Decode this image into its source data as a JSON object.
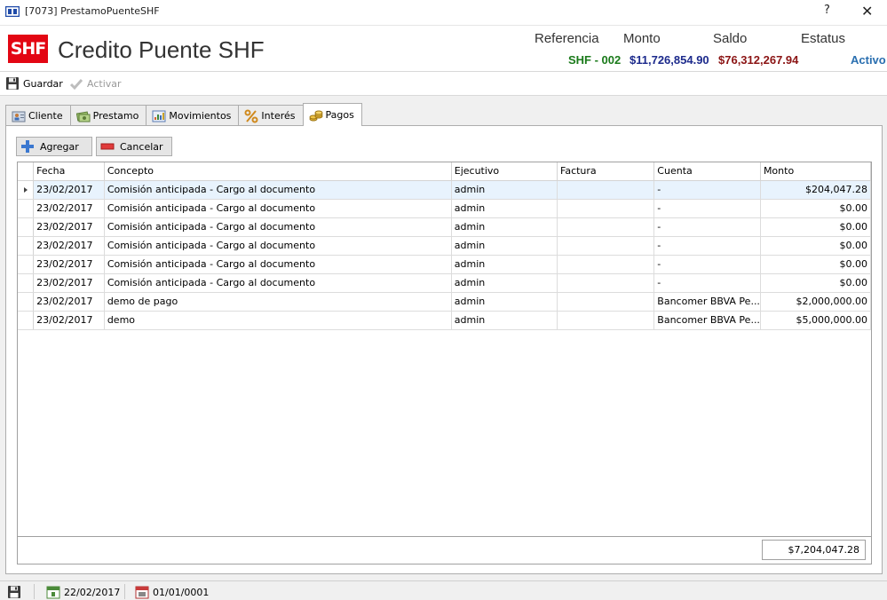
{
  "window": {
    "title": "[7073] PrestamoPuenteSHF",
    "help": "?",
    "close": "✕"
  },
  "header": {
    "logo": "SHF",
    "title": "Credito Puente SHF",
    "labels": {
      "referencia": "Referencia",
      "monto": "Monto",
      "saldo": "Saldo",
      "estatus": "Estatus"
    },
    "values": {
      "referencia": "SHF - 002",
      "monto": "$11,726,854.90",
      "saldo": "$76,312,267.94",
      "estatus": "Activo"
    },
    "colors": {
      "referencia": "#1a7a1a",
      "monto": "#1c2a8c",
      "saldo": "#8b1414",
      "estatus": "#2a6fb0"
    }
  },
  "toolbar": {
    "save_label": "Guardar",
    "activate_label": "Activar"
  },
  "tabs": [
    {
      "label": "Cliente",
      "icon": "client-icon"
    },
    {
      "label": "Prestamo",
      "icon": "loan-icon"
    },
    {
      "label": "Movimientos",
      "icon": "movements-icon"
    },
    {
      "label": "Interés",
      "icon": "percent-icon"
    },
    {
      "label": "Pagos",
      "icon": "coins-icon",
      "active": true
    }
  ],
  "actions": {
    "add_label": "Agregar",
    "cancel_label": "Cancelar"
  },
  "grid": {
    "columns": [
      "Fecha",
      "Concepto",
      "Ejecutivo",
      "Factura",
      "Cuenta",
      "Monto"
    ],
    "rows": [
      {
        "fecha": "23/02/2017",
        "concepto": "Comisión anticipada - Cargo al documento",
        "ejecutivo": "admin",
        "factura": "",
        "cuenta": "-",
        "monto": "$204,047.28"
      },
      {
        "fecha": "23/02/2017",
        "concepto": "Comisión anticipada - Cargo al documento",
        "ejecutivo": "admin",
        "factura": "",
        "cuenta": "-",
        "monto": "$0.00"
      },
      {
        "fecha": "23/02/2017",
        "concepto": "Comisión anticipada - Cargo al documento",
        "ejecutivo": "admin",
        "factura": "",
        "cuenta": "-",
        "monto": "$0.00"
      },
      {
        "fecha": "23/02/2017",
        "concepto": "Comisión anticipada - Cargo al documento",
        "ejecutivo": "admin",
        "factura": "",
        "cuenta": "-",
        "monto": "$0.00"
      },
      {
        "fecha": "23/02/2017",
        "concepto": "Comisión anticipada - Cargo al documento",
        "ejecutivo": "admin",
        "factura": "",
        "cuenta": "-",
        "monto": "$0.00"
      },
      {
        "fecha": "23/02/2017",
        "concepto": "Comisión anticipada - Cargo al documento",
        "ejecutivo": "admin",
        "factura": "",
        "cuenta": "-",
        "monto": "$0.00"
      },
      {
        "fecha": "23/02/2017",
        "concepto": "demo de pago",
        "ejecutivo": "admin",
        "factura": "",
        "cuenta": "Bancomer BBVA Pe...",
        "monto": "$2,000,000.00"
      },
      {
        "fecha": "23/02/2017",
        "concepto": "demo",
        "ejecutivo": "admin",
        "factura": "",
        "cuenta": "Bancomer BBVA Pe...",
        "monto": "$5,000,000.00"
      }
    ],
    "total": "$7,204,047.28"
  },
  "statusbar": {
    "date_current": "22/02/2017",
    "date_other": "01/01/0001"
  }
}
